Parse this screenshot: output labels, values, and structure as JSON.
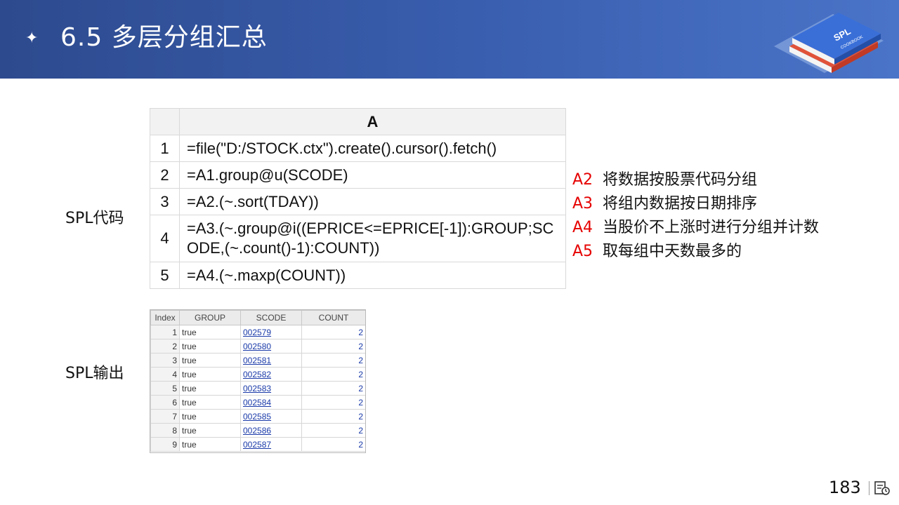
{
  "header": {
    "title": "6.5  多层分组汇总"
  },
  "labels": {
    "code": "SPL代码",
    "output": "SPL输出"
  },
  "grid": {
    "column": "A",
    "rows": [
      {
        "num": "1",
        "code": "=file(\"D:/STOCK.ctx\").create().cursor().fetch()"
      },
      {
        "num": "2",
        "code": "=A1.group@u(SCODE)"
      },
      {
        "num": "3",
        "code": "=A2.(~.sort(TDAY))"
      },
      {
        "num": "4",
        "code": "=A3.(~.group@i((EPRICE<=EPRICE[-1]):GROUP;SCODE,(~.count()-1):COUNT))"
      },
      {
        "num": "5",
        "code": "=A4.(~.maxp(COUNT))"
      }
    ]
  },
  "notes": [
    {
      "id": "A2",
      "text": "将数据按股票代码分组"
    },
    {
      "id": "A3",
      "text": "将组内数据按日期排序"
    },
    {
      "id": "A4",
      "text": "当股价不上涨时进行分组并计数"
    },
    {
      "id": "A5",
      "text": "取每组中天数最多的"
    }
  ],
  "result": {
    "columns": [
      "Index",
      "GROUP",
      "SCODE",
      "COUNT"
    ],
    "rows": [
      [
        "1",
        "true",
        "002579",
        "2"
      ],
      [
        "2",
        "true",
        "002580",
        "2"
      ],
      [
        "3",
        "true",
        "002581",
        "2"
      ],
      [
        "4",
        "true",
        "002582",
        "2"
      ],
      [
        "5",
        "true",
        "002583",
        "2"
      ],
      [
        "6",
        "true",
        "002584",
        "2"
      ],
      [
        "7",
        "true",
        "002585",
        "2"
      ],
      [
        "8",
        "true",
        "002586",
        "2"
      ],
      [
        "9",
        "true",
        "002587",
        "2"
      ]
    ]
  },
  "footer": {
    "page": "183"
  },
  "logo": {
    "line1": "SPL",
    "line2": "COOKBOOK"
  }
}
